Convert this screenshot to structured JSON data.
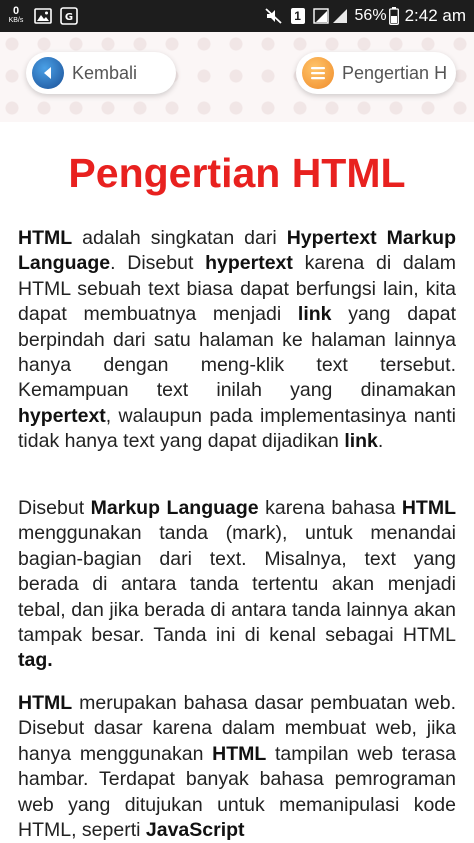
{
  "status_bar": {
    "net_speed_value": "0",
    "net_speed_unit": "KB/s",
    "battery": "56%",
    "time": "2:42 am",
    "sim_badge": "1"
  },
  "nav": {
    "back_label": "Kembali",
    "title_label": "Pengertian H"
  },
  "article": {
    "title": "Pengertian HTML",
    "p1": [
      {
        "t": "HTML",
        "b": true
      },
      {
        "t": " adalah singkatan dari ",
        "b": false
      },
      {
        "t": "Hypertext Markup Language",
        "b": true
      },
      {
        "t": ". Disebut ",
        "b": false
      },
      {
        "t": "hypertext",
        "b": true
      },
      {
        "t": " karena di dalam HTML sebuah text biasa dapat berfungsi lain, kita dapat membuatnya menjadi ",
        "b": false
      },
      {
        "t": "link",
        "b": true
      },
      {
        "t": " yang dapat berpindah dari satu halaman ke halaman lainnya hanya dengan meng-klik text tersebut. Kemampuan text inilah yang dinamakan ",
        "b": false
      },
      {
        "t": "hypertext",
        "b": true
      },
      {
        "t": ", walaupun pada implementasinya nanti tidak hanya text yang dapat dijadikan ",
        "b": false
      },
      {
        "t": "link",
        "b": true
      },
      {
        "t": ".",
        "b": false
      }
    ],
    "p2": [
      {
        "t": "Disebut ",
        "b": false
      },
      {
        "t": "Markup Language",
        "b": true
      },
      {
        "t": " karena bahasa ",
        "b": false
      },
      {
        "t": "HTML",
        "b": true
      },
      {
        "t": " menggunakan tanda (mark), untuk menandai bagian-bagian dari text. Misalnya, text yang berada di antara tanda tertentu akan menjadi tebal, dan jika berada di antara tanda lainnya akan tampak besar. Tanda ini di kenal sebagai HTML ",
        "b": false
      },
      {
        "t": "tag.",
        "b": true
      }
    ],
    "p3": [
      {
        "t": "HTML",
        "b": true
      },
      {
        "t": " merupakan bahasa dasar pembuatan web. Disebut dasar karena dalam membuat web, jika hanya menggunakan ",
        "b": false
      },
      {
        "t": "HTML",
        "b": true
      },
      {
        "t": " tampilan web terasa hambar. Terdapat banyak bahasa pemrograman web yang ditujukan untuk memanipulasi kode HTML, seperti ",
        "b": false
      },
      {
        "t": "JavaScript",
        "b": true
      }
    ]
  },
  "colors": {
    "title": "#e8211f",
    "status_bar_bg": "#1d1d1d",
    "back_circle": "#1a4f96",
    "menu_circle": "#f08b2a"
  },
  "icons": {
    "gallery": "image-icon",
    "translate": "translate-icon",
    "mute": "mute-icon",
    "signal": "signal-icon",
    "battery": "battery-icon",
    "back": "back-arrow-icon",
    "menu": "menu-icon"
  }
}
